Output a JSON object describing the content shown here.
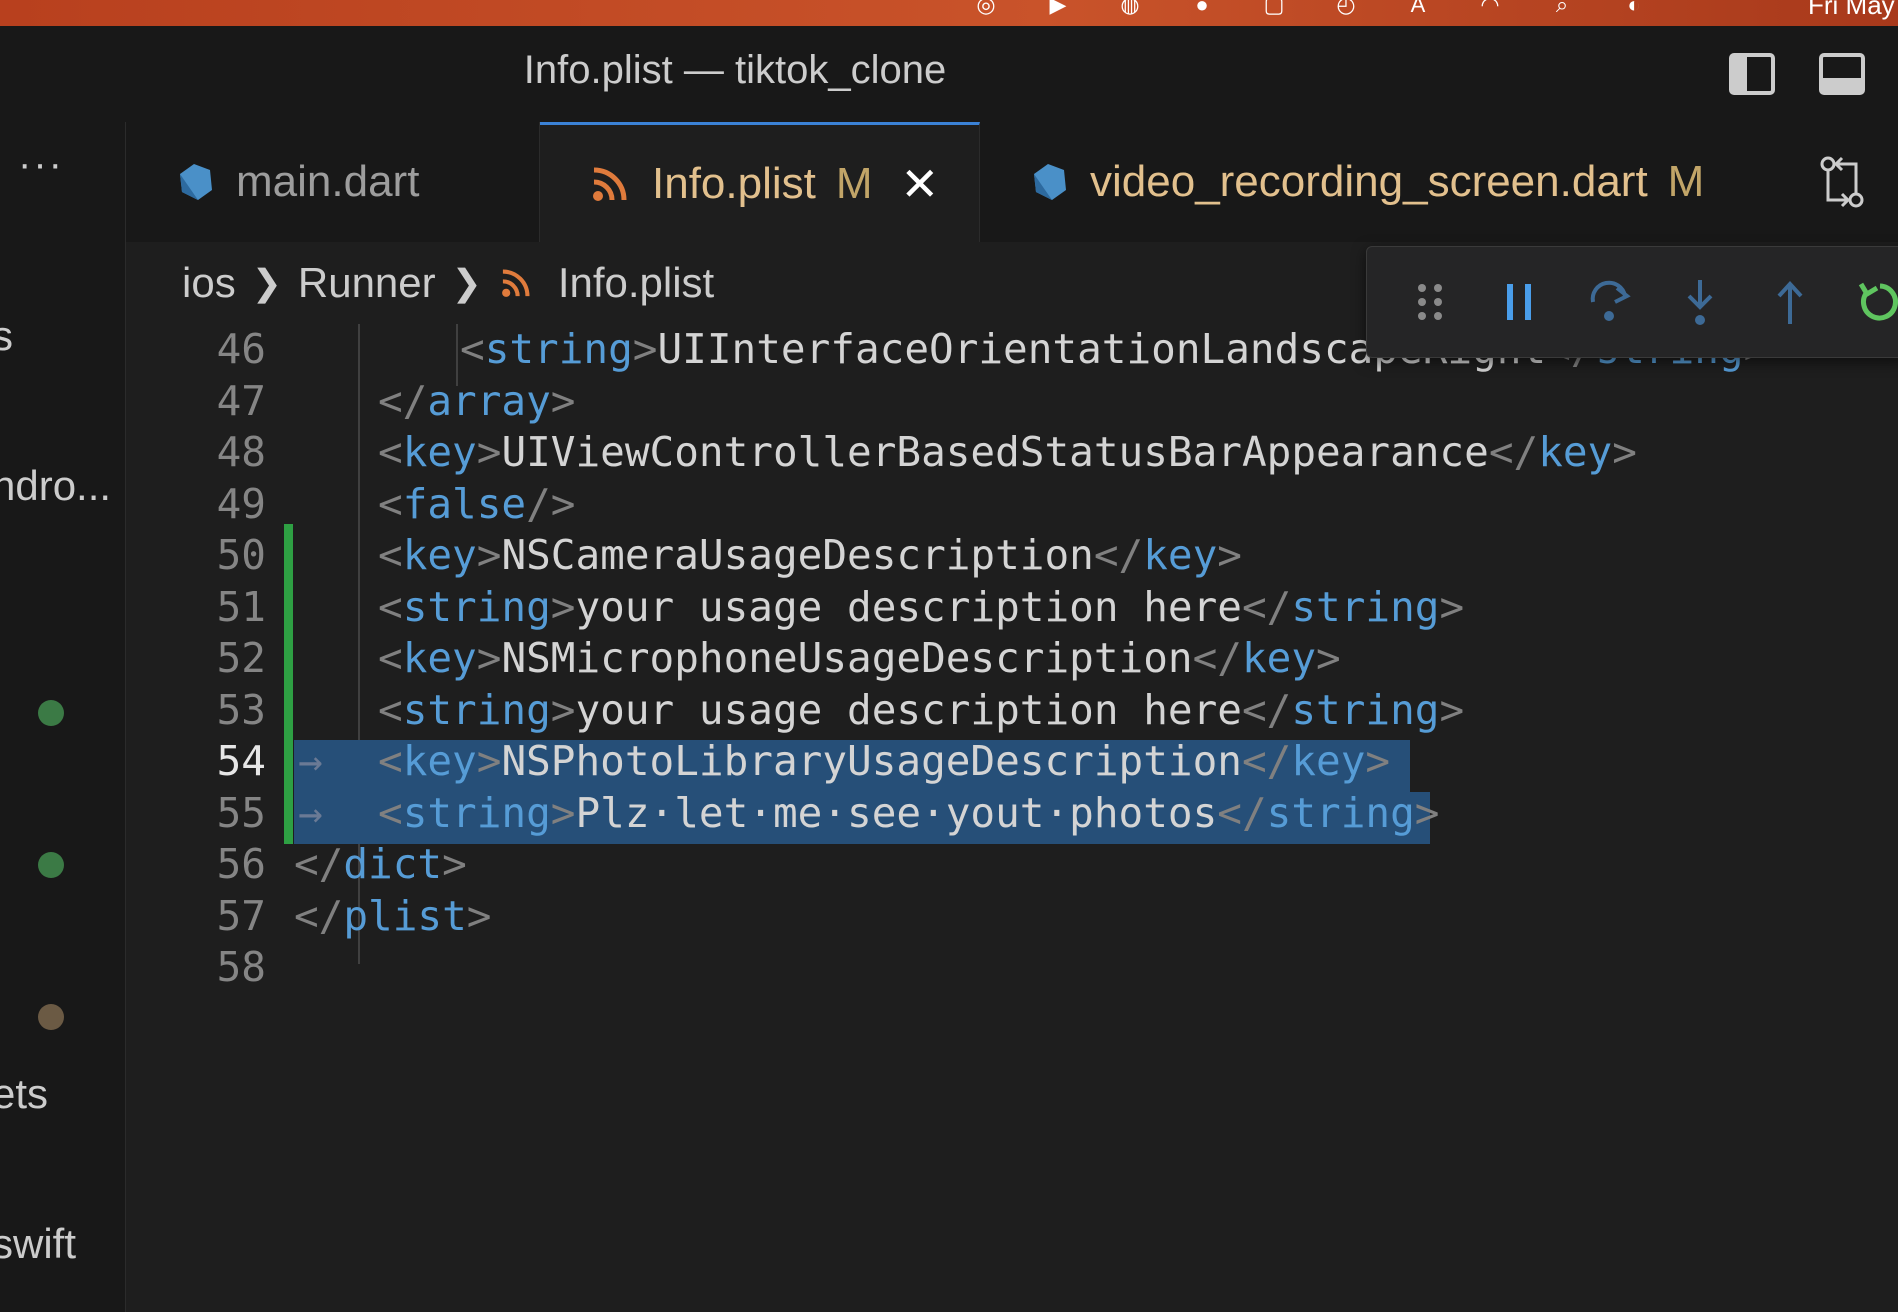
{
  "window": {
    "title": "Info.plist — tiktok_clone"
  },
  "menubar": {
    "clock": "Fri May"
  },
  "sidebar": {
    "more_label": "···",
    "fragments": [
      "s",
      "ndro...",
      "ets",
      "swift"
    ],
    "dots": [
      {
        "color": "#3b7a45"
      },
      {
        "color": "#3b7a45"
      },
      {
        "color": "#6b5a44"
      }
    ]
  },
  "tabs": [
    {
      "label": "main.dart",
      "icon": "dart-icon",
      "modified": "",
      "active": false,
      "color": "#9d9d9d"
    },
    {
      "label": "Info.plist",
      "icon": "rss-icon",
      "modified": "M",
      "active": true,
      "color": "#e2c08d"
    },
    {
      "label": "video_recording_screen.dart",
      "icon": "dart-icon",
      "modified": "M",
      "active": false,
      "color": "#e2c08d"
    }
  ],
  "breadcrumb": {
    "items": [
      "ios",
      "Runner",
      "Info.plist"
    ]
  },
  "debug_toolbar": {
    "buttons": [
      "drag-handle-icon",
      "pause-icon",
      "step-over-icon",
      "step-into-icon",
      "step-out-icon",
      "restart-icon"
    ]
  },
  "editor": {
    "current_line": "54",
    "lines": [
      {
        "n": "46",
        "open": "<",
        "tag": "string",
        "close": ">",
        "text": "UIInterfaceOrientationLandscapeRight",
        "etag_open": "</",
        "etag": "string",
        "etag_close": ">"
      },
      {
        "n": "47",
        "open": "</",
        "tag": "array",
        "close": ">",
        "text": "",
        "etag_open": "",
        "etag": "",
        "etag_close": ""
      },
      {
        "n": "48",
        "open": "<",
        "tag": "key",
        "close": ">",
        "text": "UIViewControllerBasedStatusBarAppearance",
        "etag_open": "</",
        "etag": "key",
        "etag_close": ">"
      },
      {
        "n": "49",
        "open": "<",
        "tag": "false",
        "close": "/>",
        "text": "",
        "etag_open": "",
        "etag": "",
        "etag_close": ""
      },
      {
        "n": "50",
        "open": "<",
        "tag": "key",
        "close": ">",
        "text": "NSCameraUsageDescription",
        "etag_open": "</",
        "etag": "key",
        "etag_close": ">"
      },
      {
        "n": "51",
        "open": "<",
        "tag": "string",
        "close": ">",
        "text": "your usage description here",
        "etag_open": "</",
        "etag": "string",
        "etag_close": ">"
      },
      {
        "n": "52",
        "open": "<",
        "tag": "key",
        "close": ">",
        "text": "NSMicrophoneUsageDescription",
        "etag_open": "</",
        "etag": "key",
        "etag_close": ">"
      },
      {
        "n": "53",
        "open": "<",
        "tag": "string",
        "close": ">",
        "text": "your usage description here",
        "etag_open": "</",
        "etag": "string",
        "etag_close": ">"
      },
      {
        "n": "54",
        "open": "<",
        "tag": "key",
        "close": ">",
        "text": "NSPhotoLibraryUsageDescription",
        "etag_open": "</",
        "etag": "key",
        "etag_close": ">"
      },
      {
        "n": "55",
        "open": "<",
        "tag": "string",
        "close": ">",
        "text": "Plz·let·me·see·yout·photos",
        "etag_open": "</",
        "etag": "string",
        "etag_close": ">"
      },
      {
        "n": "56",
        "open": "</",
        "tag": "dict",
        "close": ">",
        "text": "",
        "etag_open": "",
        "etag": "",
        "etag_close": ""
      },
      {
        "n": "57",
        "open": "</",
        "tag": "plist",
        "close": ">",
        "text": "",
        "etag_open": "",
        "etag": "",
        "etag_close": ""
      },
      {
        "n": "58",
        "open": "",
        "tag": "",
        "close": "",
        "text": "",
        "etag_open": "",
        "etag": "",
        "etag_close": ""
      }
    ]
  }
}
